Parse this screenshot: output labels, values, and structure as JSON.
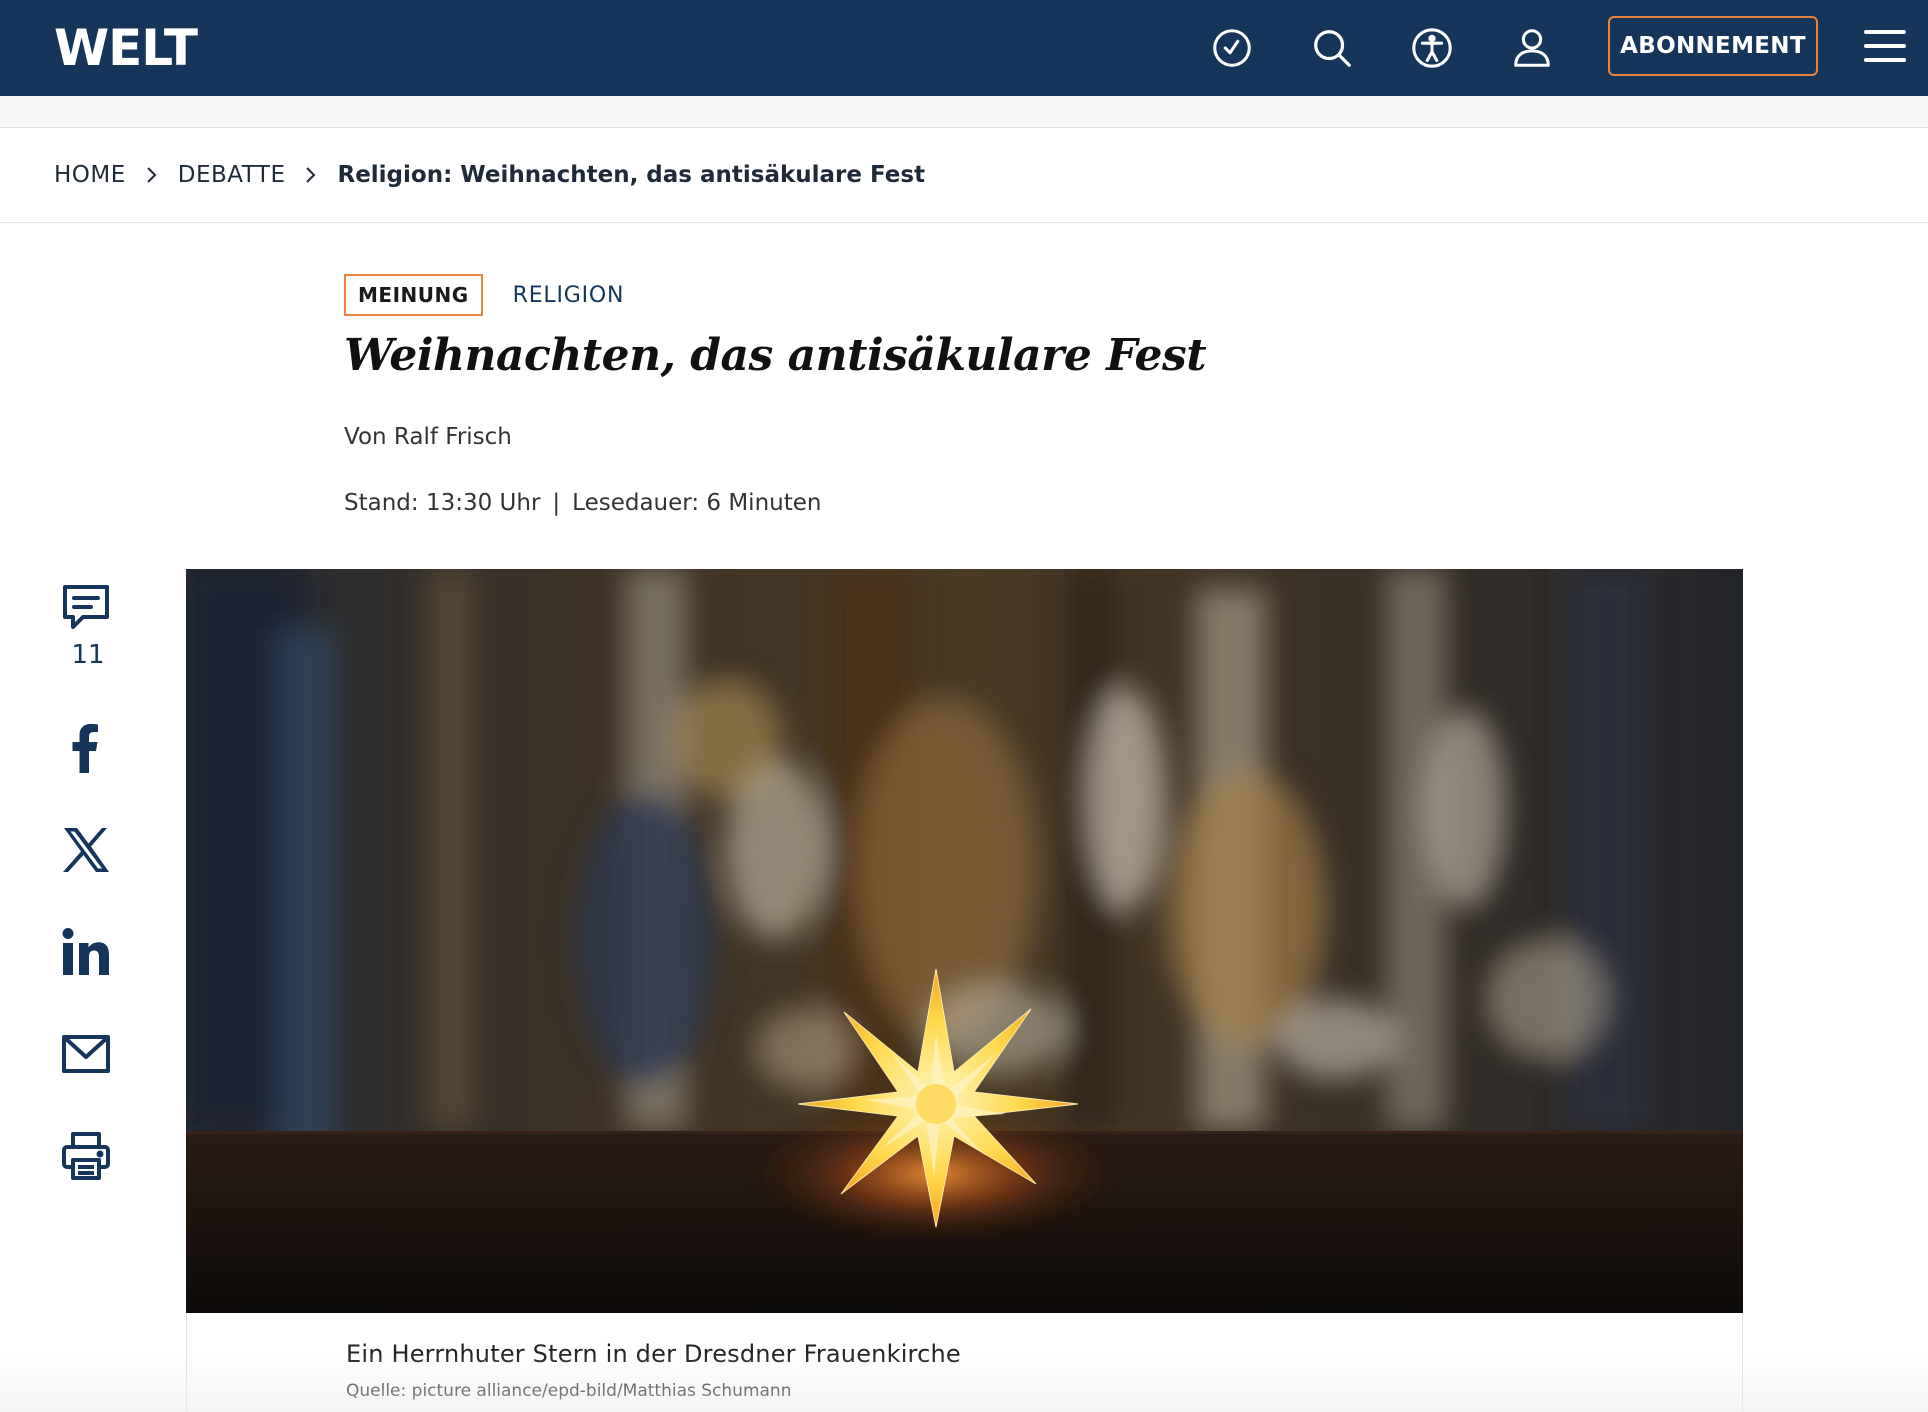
{
  "header": {
    "logo": "WELT",
    "subscribe_label": "ABONNEMENT",
    "icons": [
      "history-icon",
      "search-icon",
      "accessibility-icon",
      "user-icon",
      "menu-icon"
    ],
    "background_color": "#15355a",
    "accent_color": "#e9823c"
  },
  "breadcrumb": {
    "items": [
      "HOME",
      "DEBATTE"
    ],
    "current": "Religion: Weihnachten, das antisäkulare Fest"
  },
  "article": {
    "category_badge": "MEINUNG",
    "topic": "RELIGION",
    "headline": "Weihnachten, das antisäkulare Fest",
    "author": "Von Ralf Frisch",
    "time": "Stand: 13:30 Uhr",
    "separator": "|",
    "reading_time": "Lesedauer: 6 Minuten"
  },
  "share": {
    "comment_count": "11",
    "icons": [
      "comment-icon",
      "facebook-icon",
      "x-icon",
      "linkedin-icon",
      "mail-icon",
      "print-icon"
    ]
  },
  "image": {
    "caption": "Ein Herrnhuter Stern in der Dresdner Frauenkirche",
    "credit": "Quelle: picture alliance/epd-bild/Matthias Schumann"
  }
}
